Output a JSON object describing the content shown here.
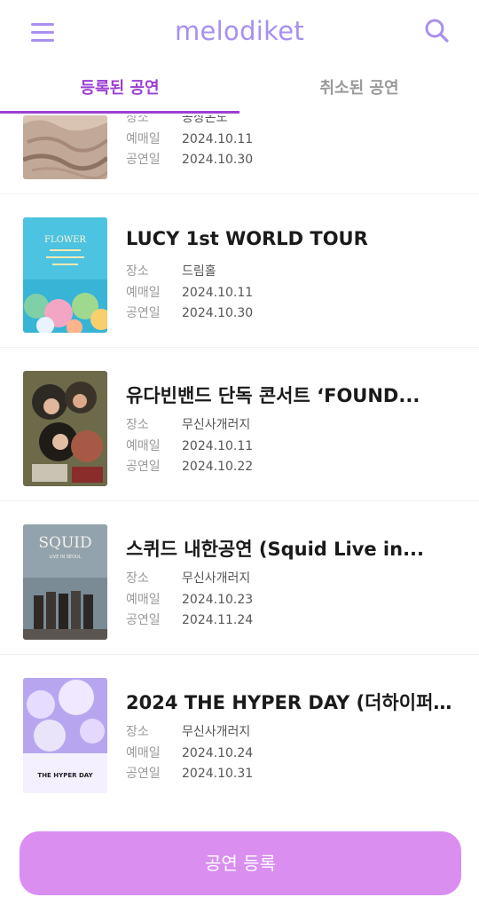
{
  "header": {
    "brand": "melodiket",
    "menu_icon": "hamburger-menu-icon",
    "search_icon": "search-icon",
    "brand_color": "#a88ff2"
  },
  "tabs": [
    {
      "label": "등록된 공연",
      "active": true
    },
    {
      "label": "취소된 공연",
      "active": false
    }
  ],
  "accent_color": "#9b3fd1",
  "labels": {
    "venue": "장소",
    "presale": "예매일",
    "show": "공연일"
  },
  "concerts": [
    {
      "title": "",
      "venue": "공상온도",
      "presale_date": "2024.10.11",
      "show_date": "2024.10.30"
    },
    {
      "title": "LUCY 1st WORLD TOUR",
      "venue": "드림홀",
      "presale_date": "2024.10.11",
      "show_date": "2024.10.30"
    },
    {
      "title": "유다빈밴드 단독 콘서트 ‘FOUND...",
      "venue": "무신사개러지",
      "presale_date": "2024.10.11",
      "show_date": "2024.10.22"
    },
    {
      "title": "스퀴드 내한공연 (Squid Live in...",
      "venue": "무신사개러지",
      "presale_date": "2024.10.23",
      "show_date": "2024.11.24"
    },
    {
      "title": "2024 THE HYPER DAY (더하이퍼...",
      "venue": "무신사개러지",
      "presale_date": "2024.10.24",
      "show_date": "2024.10.31"
    }
  ],
  "posters": {
    "lucy": {
      "text": "FLOWER"
    },
    "squid": {
      "text": "SQUID",
      "subtext": "LIVE IN SEOUL"
    },
    "hyper": {
      "text": "THE HYPER DAY",
      "big": "THE HYPER DAY"
    }
  },
  "register_button": {
    "label": "공연 등록",
    "color": "#d98ef0"
  }
}
